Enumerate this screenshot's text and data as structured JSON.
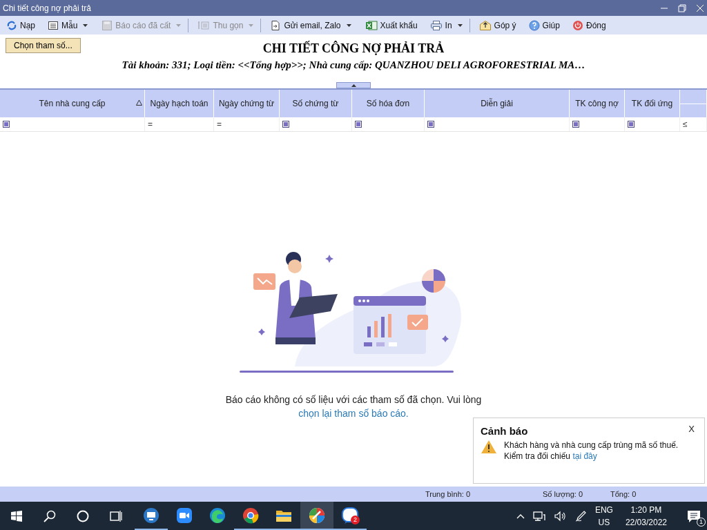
{
  "window": {
    "title": "Chi tiết công nợ phải trả"
  },
  "toolbar": [
    {
      "label": "Nạp",
      "disabled": false,
      "dropdown": false,
      "separator": false
    },
    {
      "label": "Mẫu",
      "disabled": false,
      "dropdown": true,
      "separator": false
    },
    {
      "label": "Báo cáo đã cất",
      "disabled": true,
      "dropdown": true,
      "separator": true
    },
    {
      "label": "Thu gọn",
      "disabled": true,
      "dropdown": true,
      "separator": true
    },
    {
      "label": "Gửi email, Zalo",
      "disabled": false,
      "dropdown": true,
      "separator": false
    },
    {
      "label": "Xuất khẩu",
      "disabled": false,
      "dropdown": false,
      "separator": false
    },
    {
      "label": "In",
      "disabled": false,
      "dropdown": true,
      "separator": true
    },
    {
      "label": "Góp ý",
      "disabled": false,
      "dropdown": false,
      "separator": false
    },
    {
      "label": "Giúp",
      "disabled": false,
      "dropdown": false,
      "separator": false
    },
    {
      "label": "Đóng",
      "disabled": false,
      "dropdown": false,
      "separator": false
    }
  ],
  "report": {
    "params_button": "Chọn tham số...",
    "title": "CHI TIẾT CÔNG NỢ PHẢI TRẢ",
    "subtitle": "Tài khoản: 331; Loại tiền: <<Tổng hợp>>; Nhà cung cấp: QUANZHOU DELI AGROFORESTRIAL MA…"
  },
  "table": {
    "columns": [
      {
        "label": "Tên nhà cung cấp",
        "sorted": true
      },
      {
        "label": "Ngày hạch toán",
        "sorted": false
      },
      {
        "label": "Ngày chứng từ",
        "sorted": false
      },
      {
        "label": "Số chứng từ",
        "sorted": false
      },
      {
        "label": "Số hóa đơn",
        "sorted": false
      },
      {
        "label": "Diễn giải",
        "sorted": false
      },
      {
        "label": "TK công nợ",
        "sorted": false
      },
      {
        "label": "TK đối ứng",
        "sorted": false
      }
    ],
    "filters": [
      {
        "kind": "check"
      },
      {
        "kind": "operator",
        "text": "="
      },
      {
        "kind": "operator",
        "text": "="
      },
      {
        "kind": "check"
      },
      {
        "kind": "check"
      },
      {
        "kind": "check"
      },
      {
        "kind": "check"
      },
      {
        "kind": "check"
      },
      {
        "kind": "operator",
        "text": "≤"
      }
    ]
  },
  "empty_state": {
    "message": "Báo cáo không có số liệu với các tham số đã chọn. Vui lòng",
    "link": "chọn lại tham số báo cáo."
  },
  "warning": {
    "title": "Cảnh báo",
    "close": "X",
    "message": "Khách hàng và nhà cung cấp trùng mã số thuế.",
    "check_text": "Kiểm tra đối chiếu",
    "link": "tại đây"
  },
  "status_bar": [
    {
      "label": "Trung bình: 0"
    },
    {
      "label": "Số lượng: 0"
    },
    {
      "label": "Tổng: 0"
    }
  ],
  "taskbar": {
    "apps": [
      {
        "running": true,
        "selected": false
      },
      {
        "running": false,
        "selected": false
      },
      {
        "running": false,
        "selected": false
      },
      {
        "running": true,
        "selected": false
      },
      {
        "running": true,
        "selected": false
      },
      {
        "running": true,
        "selected": true
      },
      {
        "running": true,
        "selected": false,
        "badge": "2"
      }
    ],
    "language": "ENG",
    "region": "US",
    "time": "1:20 PM",
    "date": "22/03/2022",
    "notifications": "1"
  }
}
